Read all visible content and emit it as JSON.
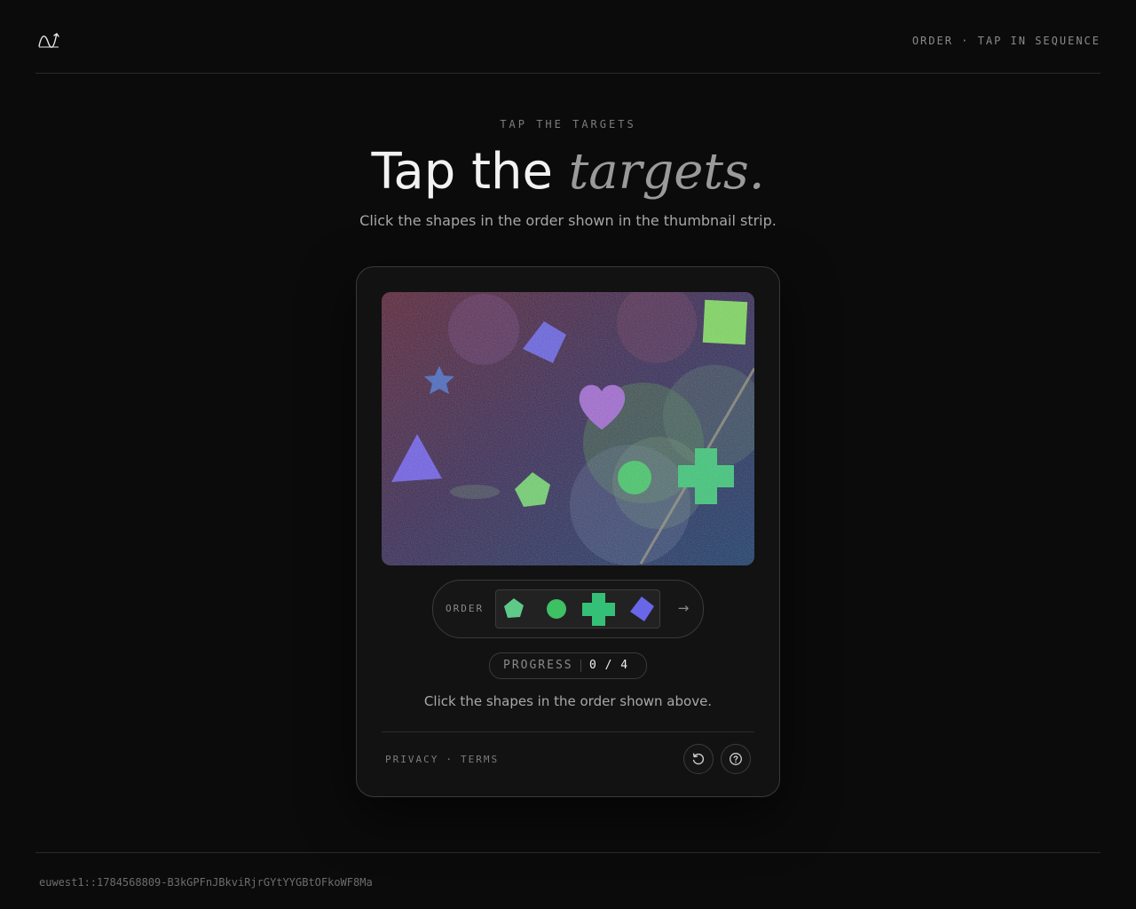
{
  "header": {
    "logo_icon": "wave-logo-icon",
    "right_label": "ORDER · TAP IN SEQUENCE"
  },
  "hero": {
    "eyebrow": "TAP THE TARGETS",
    "title_plain": "Tap the ",
    "title_accent": "targets.",
    "subtitle": "Click the shapes in the order shown in the thumbnail strip."
  },
  "challenge": {
    "canvas_shapes": [
      "diamond",
      "square",
      "star",
      "heart",
      "triangle",
      "pentagon",
      "circle",
      "cross"
    ],
    "order_label": "ORDER",
    "order_sequence": [
      "pentagon",
      "circle",
      "cross",
      "diamond"
    ],
    "next_icon": "arrow-right-icon",
    "progress_label": "PROGRESS",
    "progress_value": "0 / 4",
    "progress_done": 0,
    "progress_total": 4,
    "instruction": "Click the shapes in the order shown above.",
    "colors": {
      "green": "#4fc46a",
      "blue": "#6a66e8",
      "purple": "#8a5cc6"
    }
  },
  "footer_links": {
    "privacy": "PRIVACY",
    "separator": "·",
    "terms": "TERMS"
  },
  "controls": {
    "refresh_icon": "refresh-icon",
    "help_icon": "help-icon"
  },
  "footer": {
    "session_id": "euwest1::1784568809-B3kGPFnJBkviRjrGYtYYGBtOFkoWF8Ma"
  }
}
